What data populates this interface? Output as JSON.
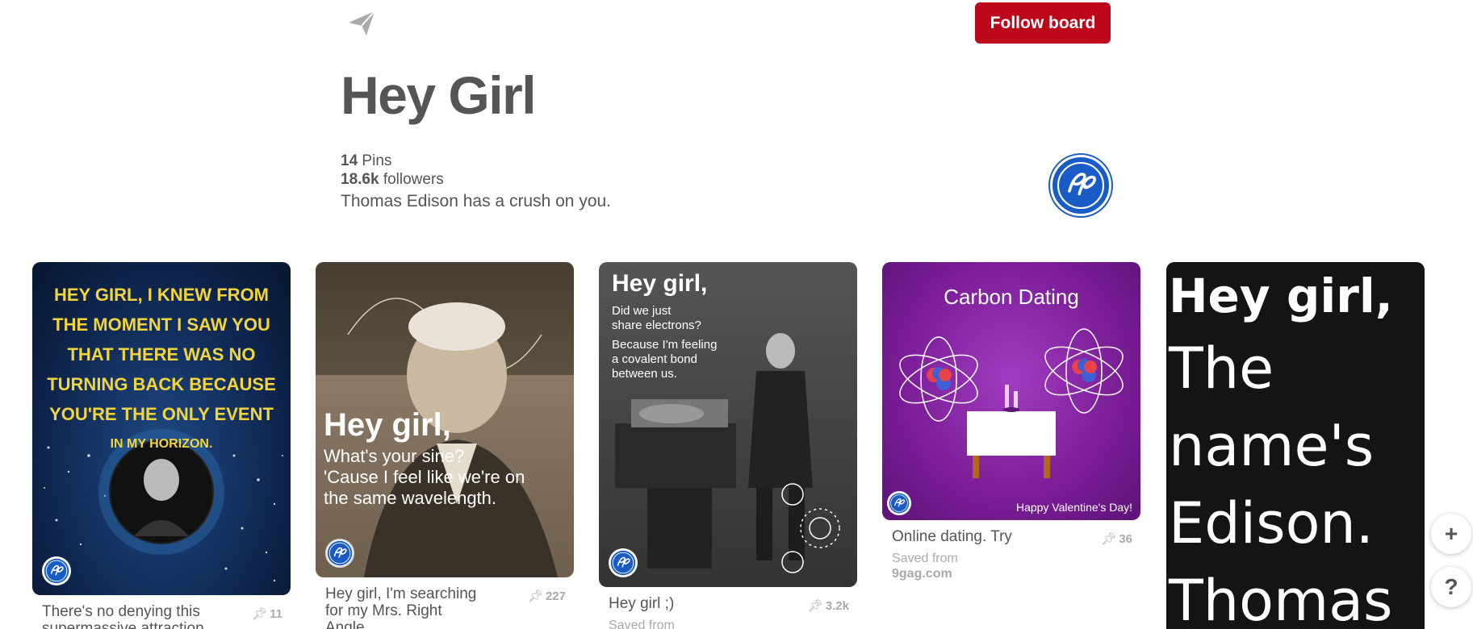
{
  "header": {
    "follow_label": "Follow board",
    "send_icon": "paper-plane-icon"
  },
  "board": {
    "title": "Hey Girl",
    "pins_count": "14",
    "pins_label": "Pins",
    "followers_count": "18.6k",
    "followers_label": "followers",
    "description": "Thomas Edison has a crush on you."
  },
  "owner": {
    "avatar_logo": "GE"
  },
  "pins": [
    {
      "image_text": [
        "HEY GIRL, I KNEW FROM",
        "THE MOMENT I SAW YOU",
        "THAT THERE WAS NO",
        "TURNING BACK BECAUSE",
        "YOU'RE THE ONLY EVENT",
        "IN MY HORIZON."
      ],
      "caption": "There's no denying this supermassive attraction...",
      "count": "11"
    },
    {
      "image_title": "Hey girl,",
      "image_text": [
        "What's your sine?",
        "'Cause I feel like we're on",
        "the same wavelength."
      ],
      "caption": "Hey girl, I'm searching for my Mrs. Right Angle...",
      "count": "227"
    },
    {
      "image_title": "Hey girl,",
      "image_text": [
        "Did we just",
        "share electrons?",
        "Because I'm feeling",
        "a covalent bond",
        "between us."
      ],
      "caption": "Hey girl ;)",
      "count": "3.2k",
      "saved_from": "Saved from"
    },
    {
      "image_title": "Carbon Dating",
      "image_footer": "Happy Valentine's Day!",
      "caption": "Online dating. Try",
      "count": "36",
      "saved_from": "Saved from",
      "saved_source": "9gag.com"
    },
    {
      "image_text": [
        "Hey girl,",
        "The",
        "name's",
        "Edison.",
        "Thomas"
      ]
    }
  ],
  "fabs": {
    "add": "+",
    "help": "?"
  },
  "colors": {
    "accent": "#bd081c",
    "ge_blue": "#1a5cc6",
    "text": "#555555",
    "muted": "#aaaaaa"
  }
}
